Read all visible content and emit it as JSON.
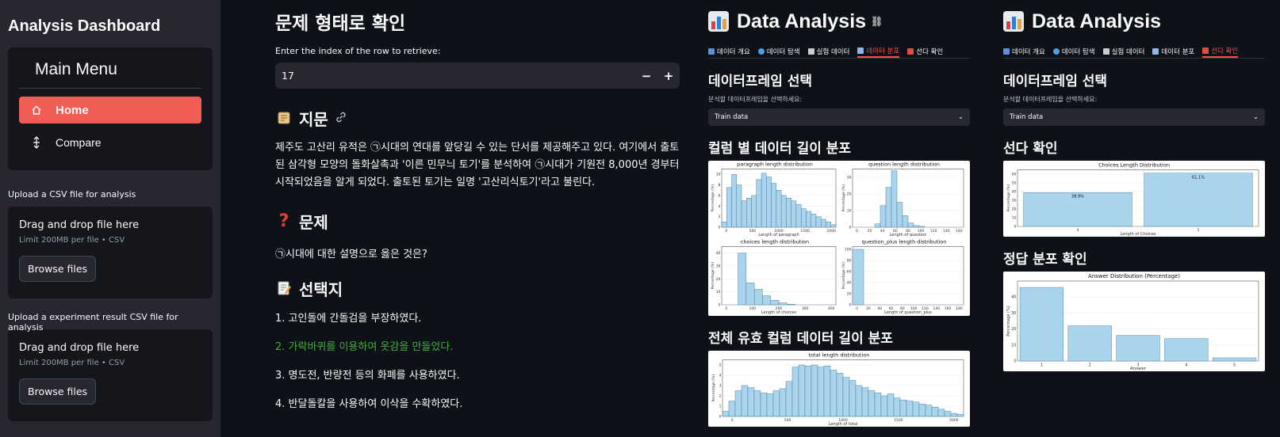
{
  "sidebar": {
    "app_title": "Analysis Dashboard",
    "menu_title": "Main Menu",
    "menu_items": [
      {
        "label": "Home",
        "icon": "house-icon"
      },
      {
        "label": "Compare",
        "icon": "compare-icon"
      }
    ],
    "uploads": [
      {
        "label": "Upload a CSV file for analysis",
        "drag_text": "Drag and drop file here",
        "limit_text": "Limit 200MB per file • CSV",
        "button": "Browse files"
      },
      {
        "label": "Upload a experiment result CSV file for analysis",
        "drag_text": "Drag and drop file here",
        "limit_text": "Limit 200MB per file • CSV",
        "button": "Browse files"
      }
    ]
  },
  "main": {
    "title": "문제 형태로 확인",
    "index_label": "Enter the index of the row to retrieve:",
    "index_value": "17",
    "minus": "−",
    "plus": "+",
    "passage_heading": "지문",
    "passage_text": "제주도 고산리 유적은 ㉠시대의 연대를 앞당길 수 있는 단서를 제공해주고 있다. 여기에서 출토된 삼각형 모양의 돌화살촉과 '이른 민무늬 토기'를 분석하여 ㉠시대가 기원전 8,000년 경부터 시작되었음을 알게 되었다. 출토된 토기는 일명 '고산리식토기'라고 불린다.",
    "question_heading": "문제",
    "question_text": "㉠시대에 대한 설명으로 옳은 것은?",
    "choices_heading": "선택지",
    "choices": [
      "1. 고인돌에 간돌검을 부장하였다.",
      "2. 가락바퀴를 이용하여 옷감을 만들었다.",
      "3. 명도전, 반량전 등의 화폐를 사용하였다.",
      "4. 반달돌칼을 사용하여 이삭을 수확하였다."
    ],
    "correct_choice_index": 1,
    "correct_color": "#3fae3b"
  },
  "panel_left": {
    "title": "Data Analysis",
    "tabs": [
      "데이터 개요",
      "데이터 탐색",
      "실험 데이터",
      "데이터 분포",
      "선다 확인"
    ],
    "active_tab": 3,
    "df_heading": "데이터프레임 선택",
    "select_hint": "분석할 데이터프레임을 선택하세요:",
    "select_value": "Train data",
    "section1": "컬럼 별 데이터 길이 분포",
    "section2": "전체 유효 컬럼 데이터 길이 분포"
  },
  "panel_right": {
    "title": "Data Analysis",
    "tabs": [
      "데이터 개요",
      "데이터 탐색",
      "실험 데이터",
      "데이터 분포",
      "선다 확인"
    ],
    "active_tab": 4,
    "df_heading": "데이터프레임 선택",
    "select_hint": "분석할 데이터프레임을 선택하세요:",
    "select_value": "Train data",
    "section1": "선다 확인",
    "section2": "정답 분포 확인"
  },
  "colors": {
    "background": "#0e1117",
    "sidebar": "#262730",
    "accent": "#f15c55",
    "active_tab": "#ff4b4b",
    "bar_fill": "#a9d4ec",
    "bar_stroke": "#3a6f99"
  },
  "chart_data": [
    {
      "type": "bar",
      "title": "paragraph length distribution",
      "xlabel": "Length of paragraph",
      "ylabel": "Percentage (%)",
      "x_ticks": [
        "0",
        "500",
        "1000",
        "1500",
        "2000"
      ],
      "y_ticks": [
        "0",
        "2",
        "4",
        "6",
        "8",
        "10"
      ],
      "ylim": [
        0,
        11
      ],
      "values": [
        1,
        7.5,
        10,
        8,
        5,
        5.5,
        6,
        9,
        10.2,
        9.5,
        8.3,
        7,
        6,
        5.5,
        5,
        4.3,
        3.5,
        3,
        2.5,
        2,
        1.5,
        1,
        0.5
      ]
    },
    {
      "type": "bar",
      "title": "question length distribution",
      "xlabel": "Length of question",
      "ylabel": "Percentage (%)",
      "x_ticks": [
        "0",
        "20",
        "40",
        "60",
        "80",
        "100",
        "120",
        "140",
        "160"
      ],
      "y_ticks": [
        "0",
        "10",
        "20",
        "30"
      ],
      "ylim": [
        0,
        35
      ],
      "values": [
        0,
        0,
        0,
        0,
        2,
        13,
        24,
        34,
        15,
        7,
        2.5,
        1,
        0.5,
        0,
        0,
        0,
        0,
        0,
        0,
        0
      ]
    },
    {
      "type": "bar",
      "title": "choices length distribution",
      "xlabel": "Length of choices",
      "ylabel": "Percentage (%)",
      "x_ticks": [
        "0",
        "100",
        "200",
        "300",
        "400"
      ],
      "y_ticks": [
        "0",
        "10",
        "20",
        "30",
        "40"
      ],
      "ylim": [
        0,
        45
      ],
      "values": [
        0,
        0,
        40,
        17,
        12,
        7,
        3.5,
        1.5,
        0.5,
        0,
        0,
        0,
        0,
        0
      ]
    },
    {
      "type": "bar",
      "title": "question_plus length distribution",
      "xlabel": "Length of question_plus",
      "ylabel": "Percentage (%)",
      "x_ticks": [
        "0",
        "20",
        "40",
        "60",
        "80",
        "100",
        "120",
        "140",
        "160",
        "180"
      ],
      "y_ticks": [
        "0",
        "20",
        "40",
        "60",
        "80",
        "100"
      ],
      "ylim": [
        0,
        105
      ],
      "values": [
        100,
        0,
        0,
        0,
        0,
        0,
        0,
        0,
        0,
        0
      ]
    },
    {
      "type": "bar",
      "title": "total length distribution",
      "xlabel": "Length of total",
      "ylabel": "Percentage (%)",
      "x_ticks": [
        "0",
        "500",
        "1000",
        "1500",
        "2000"
      ],
      "y_ticks": [
        "0",
        "1",
        "2",
        "3",
        "4",
        "5"
      ],
      "ylim": [
        0,
        5.5
      ],
      "values": [
        0.5,
        1.5,
        2.5,
        3,
        2.8,
        2.5,
        2.3,
        2.2,
        2.5,
        2.7,
        3.4,
        4.8,
        5,
        4.9,
        5,
        4.8,
        4.9,
        4.5,
        4.2,
        3.8,
        3.5,
        3,
        2.8,
        2.5,
        2.3,
        2,
        2.2,
        1.8,
        1.6,
        1.5,
        1.4,
        1.2,
        1.1,
        0.9,
        0.7,
        0.5,
        0.3,
        0.2
      ]
    },
    {
      "type": "bar",
      "title": "Choices Length Distribution",
      "xlabel": "Length of Choices",
      "ylabel": "Percentage (%)",
      "categories": [
        "4",
        "5"
      ],
      "values": [
        38.9,
        61.1
      ],
      "data_labels": [
        "38.9%",
        "61.1%"
      ],
      "y_ticks": [
        "0",
        "10",
        "20",
        "30",
        "40",
        "50",
        "60"
      ],
      "ylim": [
        0,
        65
      ]
    },
    {
      "type": "bar",
      "title": "Answer Distribution (Percentage)",
      "xlabel": "Answer",
      "ylabel": "Percentage (%)",
      "categories": [
        "1",
        "2",
        "3",
        "4",
        "5"
      ],
      "values": [
        46,
        22,
        16,
        14,
        2
      ],
      "y_ticks": [
        "0",
        "10",
        "20",
        "30",
        "40"
      ],
      "ylim": [
        0,
        50
      ]
    }
  ]
}
